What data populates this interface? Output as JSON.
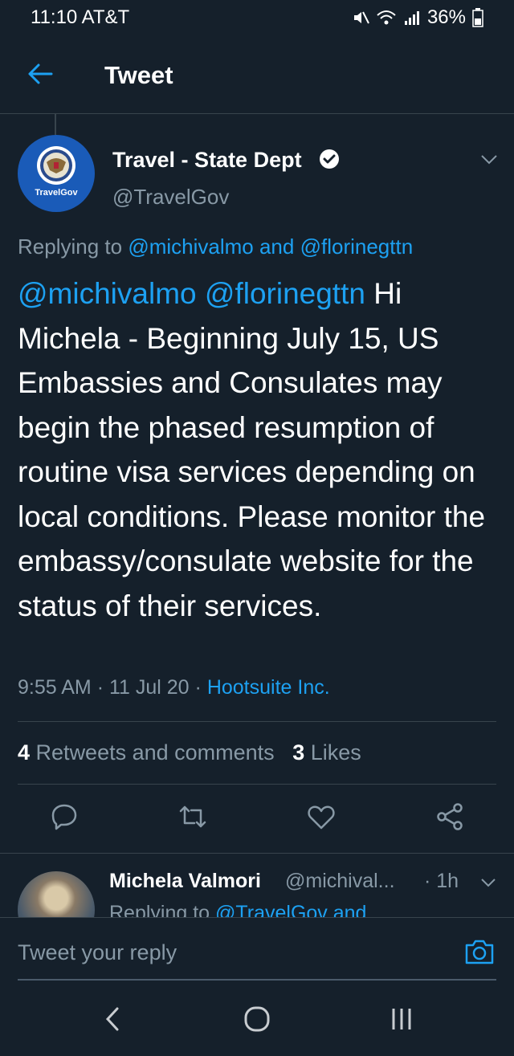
{
  "status_bar": {
    "time": "11:10",
    "carrier": "AT&T",
    "battery": "36%"
  },
  "header": {
    "title": "Tweet"
  },
  "tweet": {
    "avatar_label": "TravelGov",
    "author_name": "Travel - State Dept",
    "author_handle": "@TravelGov",
    "replying_prefix": "Replying to",
    "replying_user1": "@michivalmo",
    "replying_and": "and",
    "replying_user2": "@florinegttn",
    "mention1": "@michivalmo",
    "mention2": "@florinegttn",
    "text": "Hi Michela - Beginning July 15, US Embassies and Consulates may begin the phased resumption of routine visa services depending on local conditions. Please monitor the embassy/consulate website for the status of their services.",
    "time": "9:55 AM",
    "date": "11 Jul 20",
    "source": "Hootsuite Inc.",
    "separator": "·"
  },
  "stats": {
    "retweets_count": "4",
    "retweets_label": "Retweets and comments",
    "likes_count": "3",
    "likes_label": "Likes"
  },
  "reply": {
    "name": "Michela Valmori",
    "handle": "@michival...",
    "time": "1h",
    "separator": "·",
    "replying_prefix": "Replying to",
    "replying_user": "@TravelGov and"
  },
  "compose": {
    "placeholder": "Tweet your reply"
  },
  "colors": {
    "background": "#15202b",
    "accent": "#1da1f2",
    "secondary_text": "#8899a6",
    "divider": "#38444d"
  }
}
